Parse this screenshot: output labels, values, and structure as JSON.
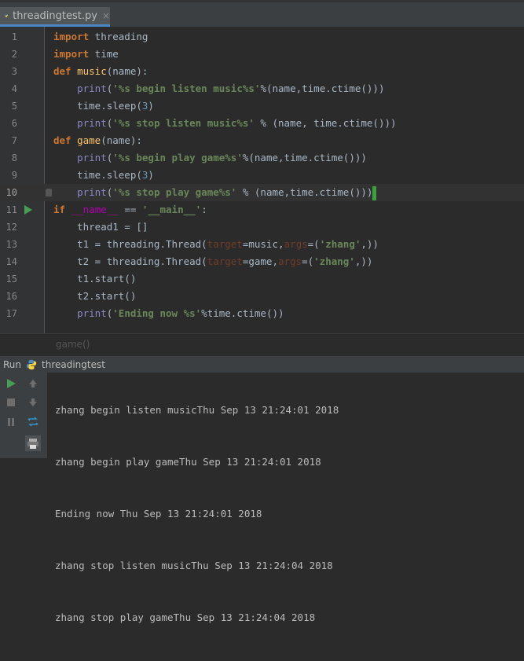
{
  "tab": {
    "title": "threadingtest.py",
    "close": "×"
  },
  "editor": {
    "line_numbers": [
      "1",
      "2",
      "3",
      "4",
      "5",
      "6",
      "7",
      "8",
      "9",
      "10",
      "11",
      "12",
      "13",
      "14",
      "15",
      "16",
      "17"
    ],
    "current_line": 10
  },
  "breadcrumb": "game()",
  "run": {
    "label": "Run",
    "name": "threadingtest"
  },
  "console": {
    "lines": [
      "zhang begin listen musicThu Sep 13 21:24:01 2018",
      "zhang begin play gameThu Sep 13 21:24:01 2018",
      "Ending now Thu Sep 13 21:24:01 2018",
      "zhang stop listen musicThu Sep 13 21:24:04 2018",
      "zhang stop play gameThu Sep 13 21:24:04 2018"
    ]
  },
  "colors": {
    "keyword": "#cc7832",
    "string": "#6a8759",
    "number": "#6897bb",
    "builtin": "#8888c6",
    "function": "#ffc66d",
    "accent": "#4a88c7"
  },
  "icons": [
    "python-file-icon",
    "run-arrow-icon",
    "play-icon",
    "stop-icon",
    "pause-icon",
    "up-arrow-icon",
    "down-arrow-icon",
    "rerun-icon",
    "print-icon"
  ]
}
